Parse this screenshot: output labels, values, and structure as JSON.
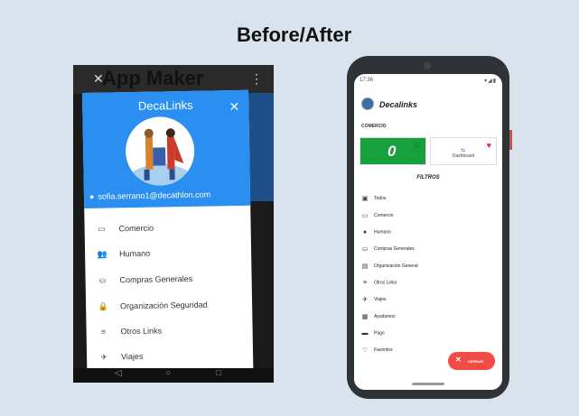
{
  "slide": {
    "title": "Before/After"
  },
  "before": {
    "overlay_title": "App Maker",
    "drawer_name": "DecaLinks",
    "email": "sofia.serrano1@decathlon.com",
    "menu": [
      {
        "icon": "store-icon",
        "label": "Comercio"
      },
      {
        "icon": "people-icon",
        "label": "Humano"
      },
      {
        "icon": "basket-icon",
        "label": "Compras Generales"
      },
      {
        "icon": "lock-icon",
        "label": "Organización Seguridad"
      },
      {
        "icon": "links-icon",
        "label": "Otros Links"
      },
      {
        "icon": "plane-icon",
        "label": "Viajes"
      }
    ]
  },
  "after": {
    "status_time": "17:36",
    "app_title": "Decalinks",
    "section_label": "COMERCIO",
    "cards": [
      {
        "name": "green-app-card",
        "favorite": false
      },
      {
        "name": "dashboard-card",
        "label": "Dashboard",
        "favorite": true
      }
    ],
    "filters_title": "FILTROS",
    "filters": [
      {
        "icon": "grid-icon",
        "label": "Todos"
      },
      {
        "icon": "store-icon",
        "label": "Comercio"
      },
      {
        "icon": "person-icon",
        "label": "Humano"
      },
      {
        "icon": "basket-icon",
        "label": "Compras Generales"
      },
      {
        "icon": "lock-icon",
        "label": "Organización General"
      },
      {
        "icon": "links-icon",
        "label": "Otros Links"
      },
      {
        "icon": "plane-icon",
        "label": "Viajes"
      },
      {
        "icon": "chat-icon",
        "label": "Ayudamos"
      },
      {
        "icon": "card-icon",
        "label": "Pago"
      },
      {
        "icon": "heart-icon",
        "label": "Favoritos"
      }
    ],
    "close_button": "CERRAR"
  },
  "colors": {
    "background": "#d9e3ee",
    "old_header_blue": "#2a8ff0",
    "green_card": "#17a03c",
    "favorite_red": "#e0294b",
    "fab_red": "#f24b46"
  }
}
